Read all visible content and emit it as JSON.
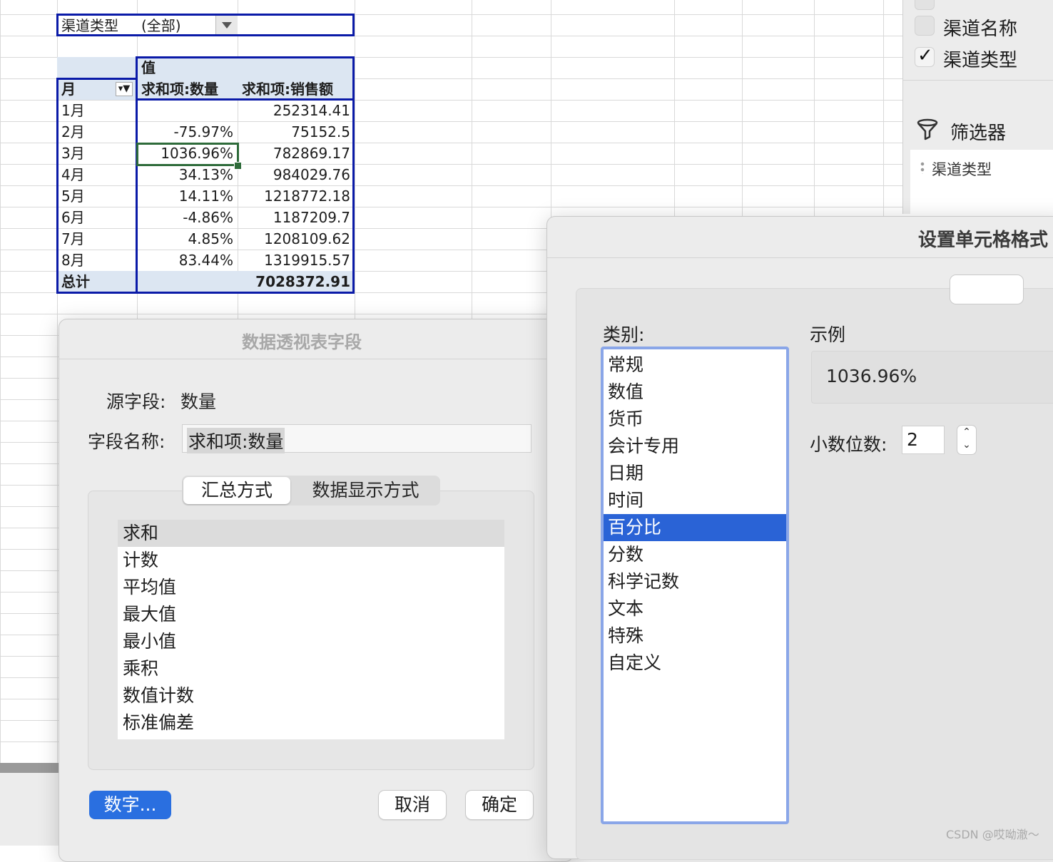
{
  "pivot_table": {
    "filter_label": "渠道类型",
    "filter_value": "(全部)",
    "values_header": "值",
    "row_header": "月",
    "col_headers": [
      "求和项:数量",
      "求和项:销售额"
    ],
    "rows": [
      {
        "month": "1月",
        "qty": "",
        "sales": "252314.41"
      },
      {
        "month": "2月",
        "qty": "-75.97%",
        "sales": "75152.5"
      },
      {
        "month": "3月",
        "qty": "1036.96%",
        "sales": "782869.17"
      },
      {
        "month": "4月",
        "qty": "34.13%",
        "sales": "984029.76"
      },
      {
        "month": "5月",
        "qty": "14.11%",
        "sales": "1218772.18"
      },
      {
        "month": "6月",
        "qty": "-4.86%",
        "sales": "1187209.7"
      },
      {
        "month": "7月",
        "qty": "4.85%",
        "sales": "1208109.62"
      },
      {
        "month": "8月",
        "qty": "83.44%",
        "sales": "1319915.57"
      }
    ],
    "total_label": "总计",
    "total_sales": "7028372.91"
  },
  "field_panel": {
    "items": [
      {
        "label": "渠道名称",
        "checked": false
      },
      {
        "label": "渠道类型",
        "checked": true
      }
    ],
    "filter_title": "筛选器",
    "filter_items": [
      "渠道类型"
    ]
  },
  "pivot_dialog": {
    "title": "数据透视表字段",
    "source_label": "源字段:",
    "source_value": "数量",
    "name_label": "字段名称:",
    "name_value": "求和项:数量",
    "tabs": [
      "汇总方式",
      "数据显示方式"
    ],
    "summary_items": [
      "求和",
      "计数",
      "平均值",
      "最大值",
      "最小值",
      "乘积",
      "数值计数",
      "标准偏差"
    ],
    "selected_summary": 0,
    "number_button": "数字...",
    "cancel_button": "取消",
    "ok_button": "确定"
  },
  "format_dialog": {
    "title": "设置单元格格式",
    "category_label": "类别:",
    "categories": [
      "常规",
      "数值",
      "货币",
      "会计专用",
      "日期",
      "时间",
      "百分比",
      "分数",
      "科学记数",
      "文本",
      "特殊",
      "自定义"
    ],
    "selected_category": 6,
    "sample_label": "示例",
    "sample_value": "1036.96%",
    "decimal_label": "小数位数:",
    "decimal_value": "2"
  },
  "watermark": "CSDN @哎呦澈～"
}
